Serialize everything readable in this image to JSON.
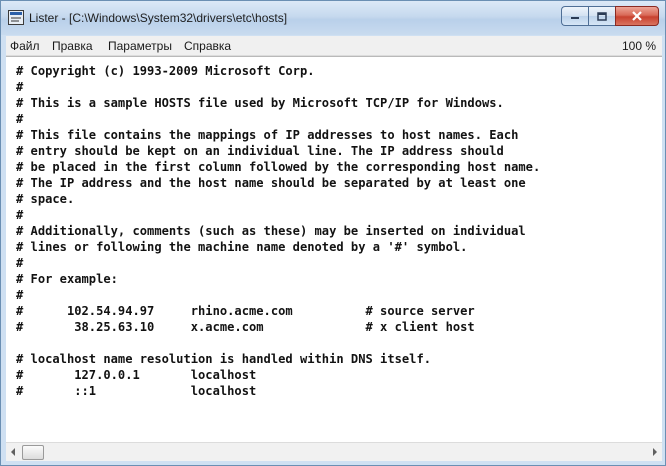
{
  "window": {
    "title": "Lister - [C:\\Windows\\System32\\drivers\\etc\\hosts]",
    "icon": "lister-app-icon",
    "controls": [
      "minimize-icon",
      "maximize-icon",
      "close-icon"
    ]
  },
  "menu": {
    "items": [
      {
        "label": "Файл"
      },
      {
        "label": "Правка"
      },
      {
        "label": "Параметры"
      },
      {
        "label": "Справка"
      }
    ],
    "zoom": "100 %"
  },
  "file_text": "# Copyright (c) 1993-2009 Microsoft Corp.\n#\n# This is a sample HOSTS file used by Microsoft TCP/IP for Windows.\n#\n# This file contains the mappings of IP addresses to host names. Each\n# entry should be kept on an individual line. The IP address should\n# be placed in the first column followed by the corresponding host name.\n# The IP address and the host name should be separated by at least one\n# space.\n#\n# Additionally, comments (such as these) may be inserted on individual\n# lines or following the machine name denoted by a '#' symbol.\n#\n# For example:\n#\n#      102.54.94.97     rhino.acme.com          # source server\n#       38.25.63.10     x.acme.com              # x client host\n\n# localhost name resolution is handled within DNS itself.\n#       127.0.0.1       localhost\n#       ::1             localhost",
  "colors": {
    "titlebar": "#c6d9ee",
    "close_button": "#c8412f",
    "menubar": "#f0f0f0",
    "text": "#121212"
  }
}
